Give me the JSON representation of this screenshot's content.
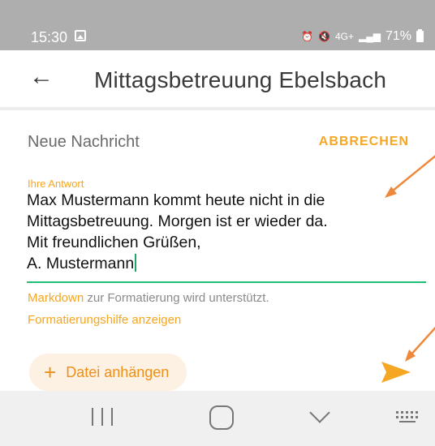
{
  "status_bar": {
    "time": "15:30",
    "battery": "71%",
    "network": "4G+",
    "icons": [
      "gallery-icon",
      "alarm-icon",
      "mute-icon",
      "network-4g-icon",
      "signal-icon",
      "battery-icon"
    ]
  },
  "app_bar": {
    "title": "Mittagsbetreuung Ebelsbach",
    "back_icon": "arrow-left-icon"
  },
  "compose": {
    "title": "Neue Nachricht",
    "cancel_label": "ABBRECHEN",
    "field_label": "Ihre Antwort",
    "reply_lines": [
      "Max Mustermann kommt heute nicht in die",
      "Mittagsbetreuung. Morgen ist er wieder da.",
      "Mit freundlichen Grüßen,",
      "A. Mustermann"
    ],
    "markdown_link": "Markdown",
    "markdown_hint": " zur Formatierung wird unterstützt.",
    "format_help": "Formatierungshilfe anzeigen",
    "attach_label": "Datei anhängen",
    "send_icon": "send-icon"
  },
  "colors": {
    "accent": "#f5a623",
    "focus_line": "#1fbf7a",
    "annotation_arrow": "#f0883c",
    "status_bar_bg": "#aeaeae",
    "nav_bar_bg": "#f0f0f0"
  }
}
